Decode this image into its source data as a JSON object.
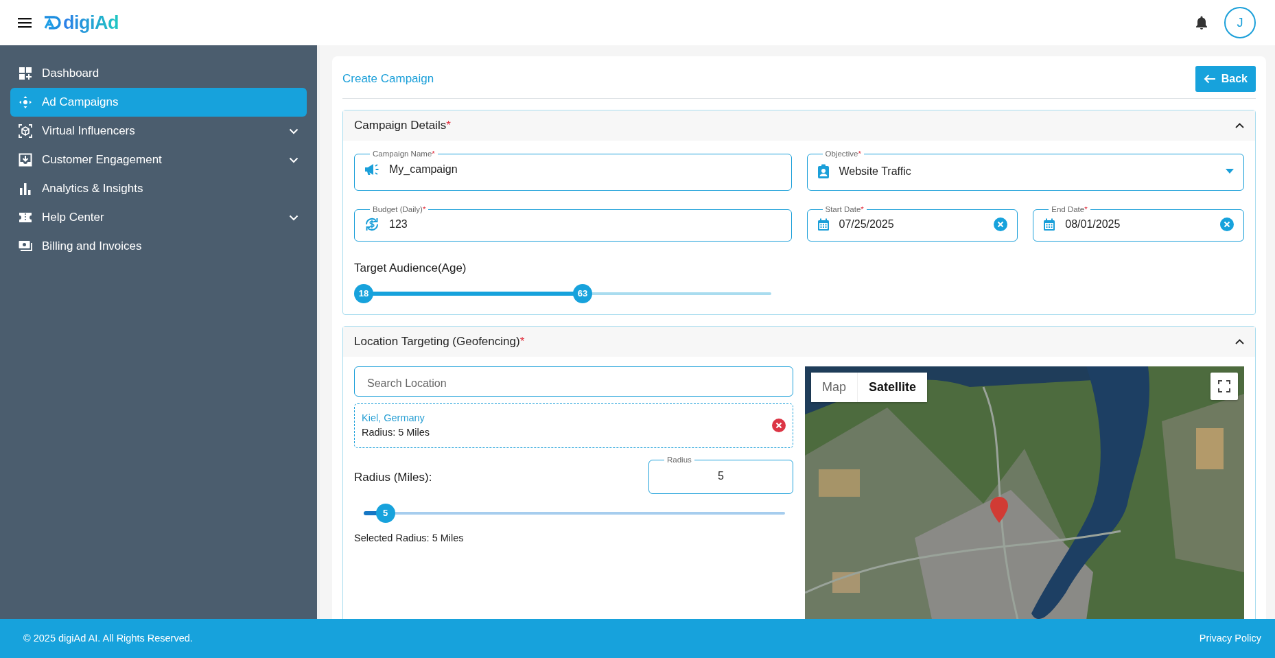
{
  "header": {
    "logo": "digiAd",
    "avatar": "J"
  },
  "sidebar": {
    "items": [
      {
        "label": "Dashboard",
        "selected": false,
        "expandable": false
      },
      {
        "label": "Ad Campaigns",
        "selected": true,
        "expandable": false
      },
      {
        "label": "Virtual Influencers",
        "selected": false,
        "expandable": true
      },
      {
        "label": "Customer Engagement",
        "selected": false,
        "expandable": true
      },
      {
        "label": "Analytics & Insights",
        "selected": false,
        "expandable": false
      },
      {
        "label": "Help Center",
        "selected": false,
        "expandable": true
      },
      {
        "label": "Billing and Invoices",
        "selected": false,
        "expandable": false
      }
    ]
  },
  "page": {
    "title": "Create Campaign",
    "back_button": "Back"
  },
  "campaign_details": {
    "title": "Campaign Details",
    "required_mark": "*",
    "expanded": true,
    "campaign_name": {
      "label": "Campaign Name",
      "required_mark": "*",
      "value": "My_campaign"
    },
    "objective": {
      "label": "Objective",
      "required_mark": "*",
      "value": "Website Traffic"
    },
    "budget": {
      "label": "Budget (Daily)",
      "required_mark": "*",
      "value": "123"
    },
    "start_date": {
      "label": "Start Date",
      "required_mark": "*",
      "value": "07/25/2025"
    },
    "end_date": {
      "label": "End Date",
      "required_mark": "*",
      "value": "08/01/2025"
    },
    "age": {
      "label": "Target Audience(Age)",
      "thumbs": [
        {
          "value": "18",
          "level": 0
        },
        {
          "value": "63",
          "level": 0.55
        }
      ]
    }
  },
  "location": {
    "title": "Location Targeting (Geofencing)",
    "required_mark": "*",
    "expanded": true,
    "search": {
      "placeholder": "Search Location"
    },
    "selected_locations": [
      {
        "name": "Kiel, Germany",
        "radius": "Radius: 5 Miles"
      }
    ],
    "radius_label": "Radius (Miles):",
    "radius_field": {
      "label": "Radius",
      "value": "5"
    },
    "radius_slider": {
      "value": "5",
      "level": 0.03
    },
    "selected_radius": "Selected Radius: 5 Miles",
    "map": {
      "tabs": [
        {
          "label": "Map",
          "selected": false
        },
        {
          "label": "Satellite",
          "selected": true
        }
      ]
    }
  },
  "footer": {
    "copyright": "© 2025 digiAd AI. All Rights Reserved.",
    "link": "Privacy Policy"
  }
}
